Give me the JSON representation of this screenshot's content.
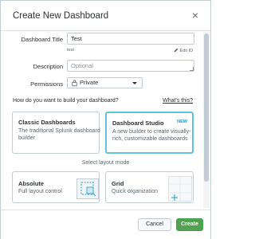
{
  "dialog": {
    "title": "Create New Dashboard",
    "close_symbol": "×"
  },
  "form": {
    "title_label": "Dashboard Title",
    "title_value": "Test",
    "id_hint": "test",
    "edit_id_label": "Edit ID",
    "description_label": "Description",
    "description_placeholder": "Optional",
    "permissions_label": "Permissions",
    "permissions_value": "Private"
  },
  "build": {
    "question": "How do you want to build your dashboard?",
    "whats_this": "What's this?",
    "options": [
      {
        "title": "Classic Dashboards",
        "description": "The traditional Splunk dashboard builder",
        "badge": "",
        "selected": false
      },
      {
        "title": "Dashboard Studio",
        "description": "A new builder to create visually-rich, customizable dashboards",
        "badge": "NEW",
        "selected": true
      }
    ]
  },
  "layout": {
    "prompt": "Select layout mode",
    "options": [
      {
        "title": "Absolute",
        "description": "Full layout control"
      },
      {
        "title": "Grid",
        "description": "Quick organization"
      }
    ]
  },
  "footer": {
    "cancel_label": "Cancel",
    "create_label": "Create"
  },
  "colors": {
    "accent": "#5cc5dd",
    "primary_button": "#53a051",
    "badge": "#1a9ccc"
  },
  "icons": [
    "close-icon",
    "pencil-icon",
    "lock-icon",
    "chevron-down-icon",
    "absolute-layout-icon",
    "grid-layout-icon"
  ]
}
